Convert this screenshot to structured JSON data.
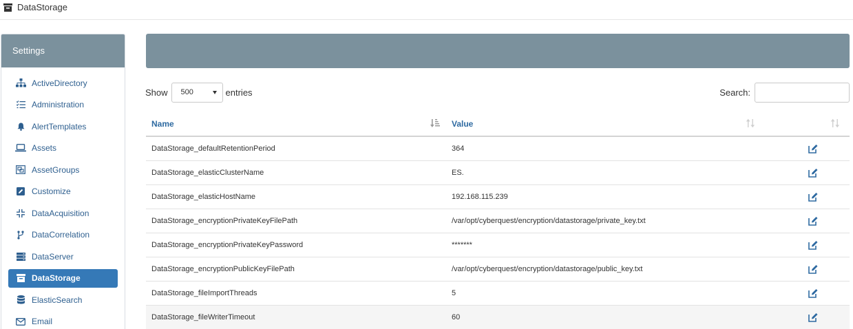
{
  "app": {
    "title": "DataStorage"
  },
  "sidebar": {
    "header": "Settings",
    "items": [
      {
        "label": "ActiveDirectory",
        "icon": "sitemap-icon",
        "active": false
      },
      {
        "label": "Administration",
        "icon": "tasks-icon",
        "active": false
      },
      {
        "label": "AlertTemplates",
        "icon": "bell-icon",
        "active": false
      },
      {
        "label": "Assets",
        "icon": "laptop-icon",
        "active": false
      },
      {
        "label": "AssetGroups",
        "icon": "object-group-icon",
        "active": false
      },
      {
        "label": "Customize",
        "icon": "edit-square-icon",
        "active": false
      },
      {
        "label": "DataAcquisition",
        "icon": "compress-icon",
        "active": false
      },
      {
        "label": "DataCorrelation",
        "icon": "code-fork-icon",
        "active": false
      },
      {
        "label": "DataServer",
        "icon": "server-icon",
        "active": false
      },
      {
        "label": "DataStorage",
        "icon": "archive-icon",
        "active": true
      },
      {
        "label": "ElasticSearch",
        "icon": "database-icon",
        "active": false
      },
      {
        "label": "Email",
        "icon": "envelope-icon",
        "active": false
      }
    ]
  },
  "table_controls": {
    "show_label": "Show",
    "entries_value": "500",
    "entries_label": "entries",
    "search_label": "Search:",
    "search_value": ""
  },
  "table": {
    "columns": [
      "Name",
      "Value"
    ],
    "rows": [
      {
        "name": "DataStorage_defaultRetentionPeriod",
        "value": "364"
      },
      {
        "name": "DataStorage_elasticClusterName",
        "value": "ES."
      },
      {
        "name": "DataStorage_elasticHostName",
        "value": "192.168.115.239"
      },
      {
        "name": "DataStorage_encryptionPrivateKeyFilePath",
        "value": "/var/opt/cyberquest/encryption/datastorage/private_key.txt"
      },
      {
        "name": "DataStorage_encryptionPrivateKeyPassword",
        "value": "*******"
      },
      {
        "name": "DataStorage_encryptionPublicKeyFilePath",
        "value": "/var/opt/cyberquest/encryption/datastorage/public_key.txt"
      },
      {
        "name": "DataStorage_fileImportThreads",
        "value": "5"
      },
      {
        "name": "DataStorage_fileWriterTimeout",
        "value": "60"
      }
    ]
  },
  "colors": {
    "accent": "#3579b7",
    "header_bar": "#7b919d",
    "link": "#2e5f8f"
  }
}
